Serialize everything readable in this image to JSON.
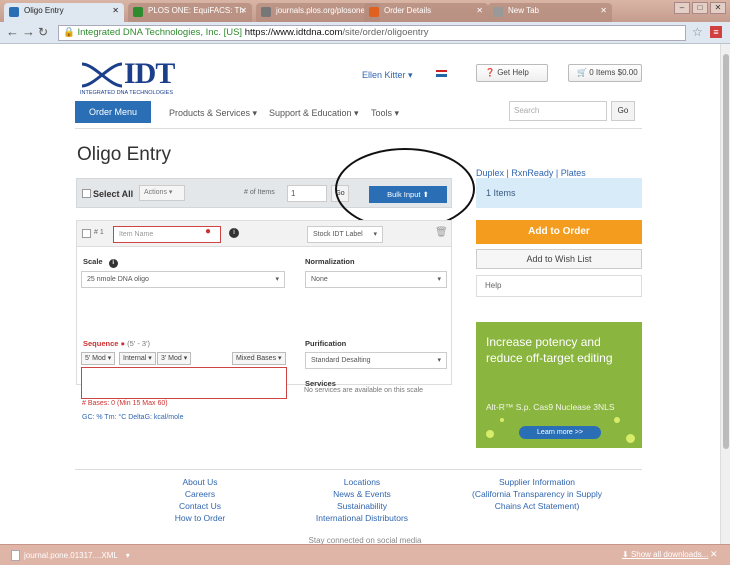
{
  "browser": {
    "tabs": [
      {
        "label": "Oligo Entry",
        "fav": "#2a6fb5"
      },
      {
        "label": "PLOS ONE: EquiFACS: Th",
        "fav": "#2e8b2e"
      },
      {
        "label": "journals.plos.org/plosone",
        "fav": "#777777"
      },
      {
        "label": "Order Details",
        "fav": "#e06020"
      },
      {
        "label": "New Tab",
        "fav": "#999999"
      }
    ],
    "address": {
      "secure_label": "Integrated DNA Technologies, Inc. [US]",
      "host": "https://www.idtdna.com",
      "path": "/site/order/oligoentry"
    }
  },
  "header": {
    "logo_word": "IDT",
    "logo_sub": "INTEGRATED DNA TECHNOLOGIES",
    "user": "Ellen Kitter ▾",
    "get_help": "Get Help",
    "cart": "0 Items $0.00"
  },
  "nav": {
    "order_menu": "Order Menu",
    "links": [
      "Products & Services ▾",
      "Support & Education ▾",
      "Tools ▾"
    ],
    "search_placeholder": "Search",
    "go": "Go"
  },
  "page": {
    "title": "Oligo Entry",
    "top_links": "Duplex | RxnReady | Plates",
    "select_all": "Select All",
    "actions": "Actions ▾",
    "num_items_label": "# of Items",
    "num_items_value": "1",
    "go": "Go",
    "bulk_input": "Bulk Input",
    "items_summary": "1 Items"
  },
  "form": {
    "row_num": "# 1",
    "item_name_placeholder": "Item Name",
    "label_select": "Stock IDT Label",
    "scale_label": "Scale",
    "scale_value": "25 nmole DNA oligo",
    "normalization_label": "Normalization",
    "normalization_value": "None",
    "sequence_label": "Sequence",
    "sequence_hint": "(5' - 3')",
    "mods": [
      "5' Mod ▾",
      "Internal ▾",
      "3' Mod ▾"
    ],
    "mixed_bases": "Mixed Bases ▾",
    "purification_label": "Purification",
    "purification_value": "Standard Desalting",
    "services_label": "Services",
    "services_note": "No services are available on this scale",
    "bases": "# Bases: 0 (Min 15 Max 60)",
    "gc_line": "GC: %   Tm: °C   DeltaG: kcal/mole"
  },
  "sidebar": {
    "add_to_order": "Add to Order",
    "wish_list": "Add to Wish List",
    "help": "Help",
    "ad_line1": "Increase potency and",
    "ad_line2": "reduce off-target editing",
    "ad_body": "Alt-R™ S.p. Cas9 Nuclease 3NLS",
    "ad_button": "Learn more >>"
  },
  "footer": {
    "col1": [
      "About Us",
      "Careers",
      "Contact Us",
      "How to Order"
    ],
    "col2": [
      "Locations",
      "News & Events",
      "Sustainability",
      "International Distributors"
    ],
    "col3": [
      "Supplier Information",
      "(California Transparency in Supply",
      "Chains Act Statement)"
    ],
    "social": "Stay connected on social media"
  },
  "downloads": {
    "file": "journal.pone.01317....XML",
    "show_all": "Show all downloads..."
  },
  "colors": {
    "primary_blue": "#2a6fb5",
    "orange": "#f39c1d",
    "ad_green": "#8ab53e"
  }
}
